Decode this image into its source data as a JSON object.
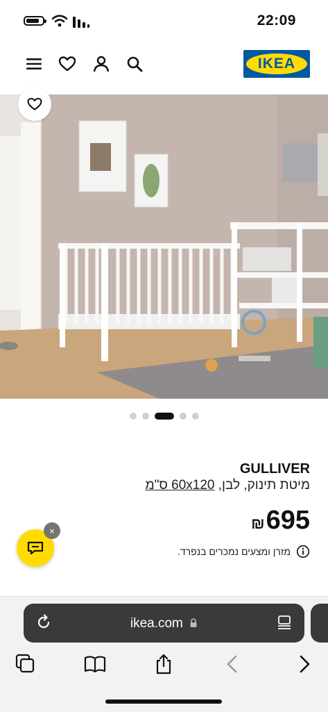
{
  "status": {
    "time": "22:09"
  },
  "header": {
    "logo_text": "IKEA",
    "icons": [
      "menu-icon",
      "heart-icon",
      "user-icon",
      "search-icon"
    ]
  },
  "carousel": {
    "count": 5,
    "active_index": 2
  },
  "product": {
    "name": "GULLIVER",
    "desc_prefix": "מיטת תינוק, לבן, ",
    "desc_size": "60x120",
    "desc_unit": " ס\"מ",
    "price": "695",
    "currency": "₪",
    "note": "מזרן ומצעים נמכרים בנפרד."
  },
  "chat": {
    "close_label": "×"
  },
  "browser": {
    "url": "ikea.com"
  },
  "colors": {
    "brand_blue": "#0058a3",
    "brand_yellow": "#ffdb00"
  }
}
